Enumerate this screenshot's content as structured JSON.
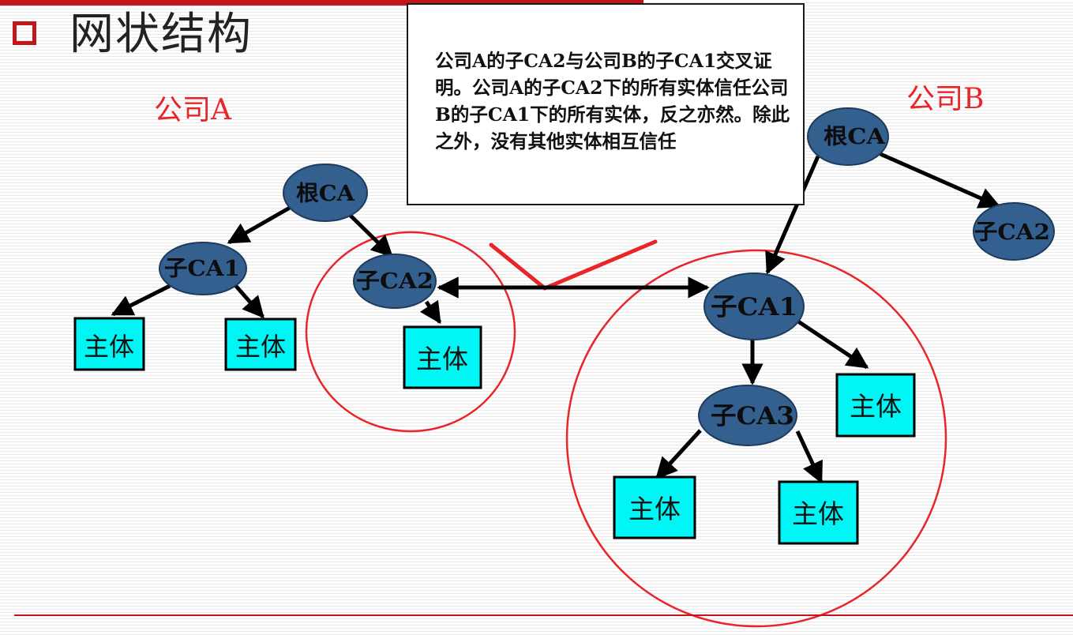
{
  "title": "网状结构",
  "company_a_label": "公司A",
  "company_b_label": "公司B",
  "note": "公司A的子CA2与公司B的子CA1交叉证明。公司A的子CA2下的所有实体信任公司B的子CA1下的所有实体，反之亦然。除此之外，没有其他实体相互信任",
  "colors": {
    "accent_red": "#c0161c",
    "annotation_red": "#e8262a",
    "ca_node_fill": "#34608f",
    "entity_fill": "#00f5f5"
  },
  "nodes": {
    "a_root_ca": "根CA",
    "a_sub_ca1": "子CA1",
    "a_sub_ca2": "子CA2",
    "b_root_ca": "根CA",
    "b_sub_ca1": "子CA1",
    "b_sub_ca2": "子CA2",
    "b_sub_ca3": "子CA3"
  },
  "entities": {
    "a_ca1_entity_1": "主体",
    "a_ca1_entity_2": "主体",
    "a_ca2_entity": "主体",
    "b_ca1_entity": "主体",
    "b_ca3_entity_1": "主体",
    "b_ca3_entity_2": "主体"
  }
}
